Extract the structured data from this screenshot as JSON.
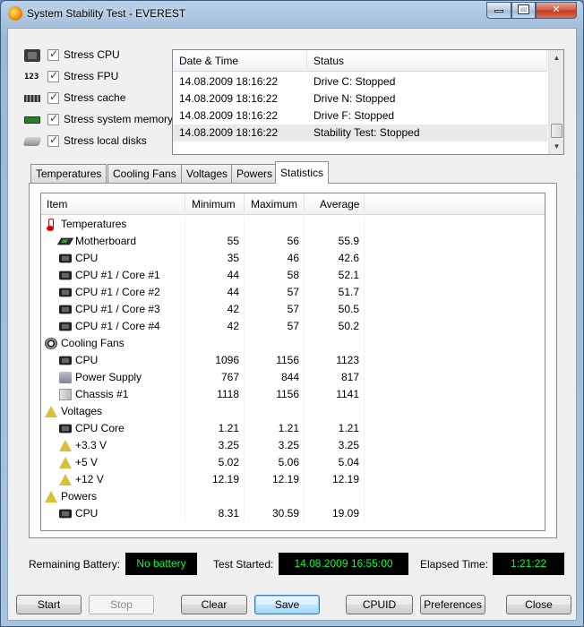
{
  "window": {
    "title": "System Stability Test - EVEREST"
  },
  "stress_options": [
    {
      "label": "Stress CPU",
      "checked": true,
      "icon": "cpu-chip-icon"
    },
    {
      "label": "Stress FPU",
      "checked": true,
      "icon": "fpu-icon"
    },
    {
      "label": "Stress cache",
      "checked": true,
      "icon": "cache-icon"
    },
    {
      "label": "Stress system memory",
      "checked": true,
      "icon": "memory-icon"
    },
    {
      "label": "Stress local disks",
      "checked": true,
      "icon": "disk-icon"
    }
  ],
  "fpu_icon_text": "123",
  "log": {
    "columns": [
      "Date & Time",
      "Status"
    ],
    "rows": [
      {
        "time": "14.08.2009 18:16:22",
        "status": "Drive C: Stopped"
      },
      {
        "time": "14.08.2009 18:16:22",
        "status": "Drive N: Stopped"
      },
      {
        "time": "14.08.2009 18:16:22",
        "status": "Drive F: Stopped"
      },
      {
        "time": "14.08.2009 18:16:22",
        "status": "Stability Test: Stopped"
      }
    ]
  },
  "tabs": [
    "Temperatures",
    "Cooling Fans",
    "Voltages",
    "Powers",
    "Statistics"
  ],
  "active_tab": "Statistics",
  "stats": {
    "columns": [
      "Item",
      "Minimum",
      "Maximum",
      "Average"
    ],
    "rows": [
      {
        "type": "group",
        "label": "Temperatures",
        "icon": "thermometer-icon"
      },
      {
        "type": "item",
        "label": "Motherboard",
        "icon": "motherboard-icon",
        "min": "55",
        "max": "56",
        "avg": "55.9"
      },
      {
        "type": "item",
        "label": "CPU",
        "icon": "chip-icon",
        "min": "35",
        "max": "46",
        "avg": "42.6"
      },
      {
        "type": "item",
        "label": "CPU #1 / Core #1",
        "icon": "chip-icon",
        "min": "44",
        "max": "58",
        "avg": "52.1"
      },
      {
        "type": "item",
        "label": "CPU #1 / Core #2",
        "icon": "chip-icon",
        "min": "44",
        "max": "57",
        "avg": "51.7"
      },
      {
        "type": "item",
        "label": "CPU #1 / Core #3",
        "icon": "chip-icon",
        "min": "42",
        "max": "57",
        "avg": "50.5"
      },
      {
        "type": "item",
        "label": "CPU #1 / Core #4",
        "icon": "chip-icon",
        "min": "42",
        "max": "57",
        "avg": "50.2"
      },
      {
        "type": "group",
        "label": "Cooling Fans",
        "icon": "fan-icon"
      },
      {
        "type": "item",
        "label": "CPU",
        "icon": "chip-icon",
        "min": "1096",
        "max": "1156",
        "avg": "1123"
      },
      {
        "type": "item",
        "label": "Power Supply",
        "icon": "power-supply-icon",
        "min": "767",
        "max": "844",
        "avg": "817"
      },
      {
        "type": "item",
        "label": "Chassis #1",
        "icon": "chassis-icon",
        "min": "1118",
        "max": "1156",
        "avg": "1141"
      },
      {
        "type": "group",
        "label": "Voltages",
        "icon": "voltage-icon"
      },
      {
        "type": "item",
        "label": "CPU Core",
        "icon": "chip-icon",
        "min": "1.21",
        "max": "1.21",
        "avg": "1.21"
      },
      {
        "type": "item",
        "label": "+3.3 V",
        "icon": "voltage-icon",
        "min": "3.25",
        "max": "3.25",
        "avg": "3.25"
      },
      {
        "type": "item",
        "label": "+5 V",
        "icon": "voltage-icon",
        "min": "5.02",
        "max": "5.06",
        "avg": "5.04"
      },
      {
        "type": "item",
        "label": "+12 V",
        "icon": "voltage-icon",
        "min": "12.19",
        "max": "12.19",
        "avg": "12.19"
      },
      {
        "type": "group",
        "label": "Powers",
        "icon": "voltage-icon"
      },
      {
        "type": "item",
        "label": "CPU",
        "icon": "chip-icon",
        "min": "8.31",
        "max": "30.59",
        "avg": "19.09"
      }
    ]
  },
  "status": {
    "battery_label": "Remaining Battery:",
    "battery_value": "No battery",
    "started_label": "Test Started:",
    "started_value": "14.08.2009 16:55:00",
    "elapsed_label": "Elapsed Time:",
    "elapsed_value": "1:21:22",
    "lcd_color": "#00ff33"
  },
  "buttons": {
    "start": "Start",
    "stop": "Stop",
    "clear": "Clear",
    "save": "Save",
    "cpuid": "CPUID",
    "preferences": "Preferences",
    "close": "Close"
  }
}
